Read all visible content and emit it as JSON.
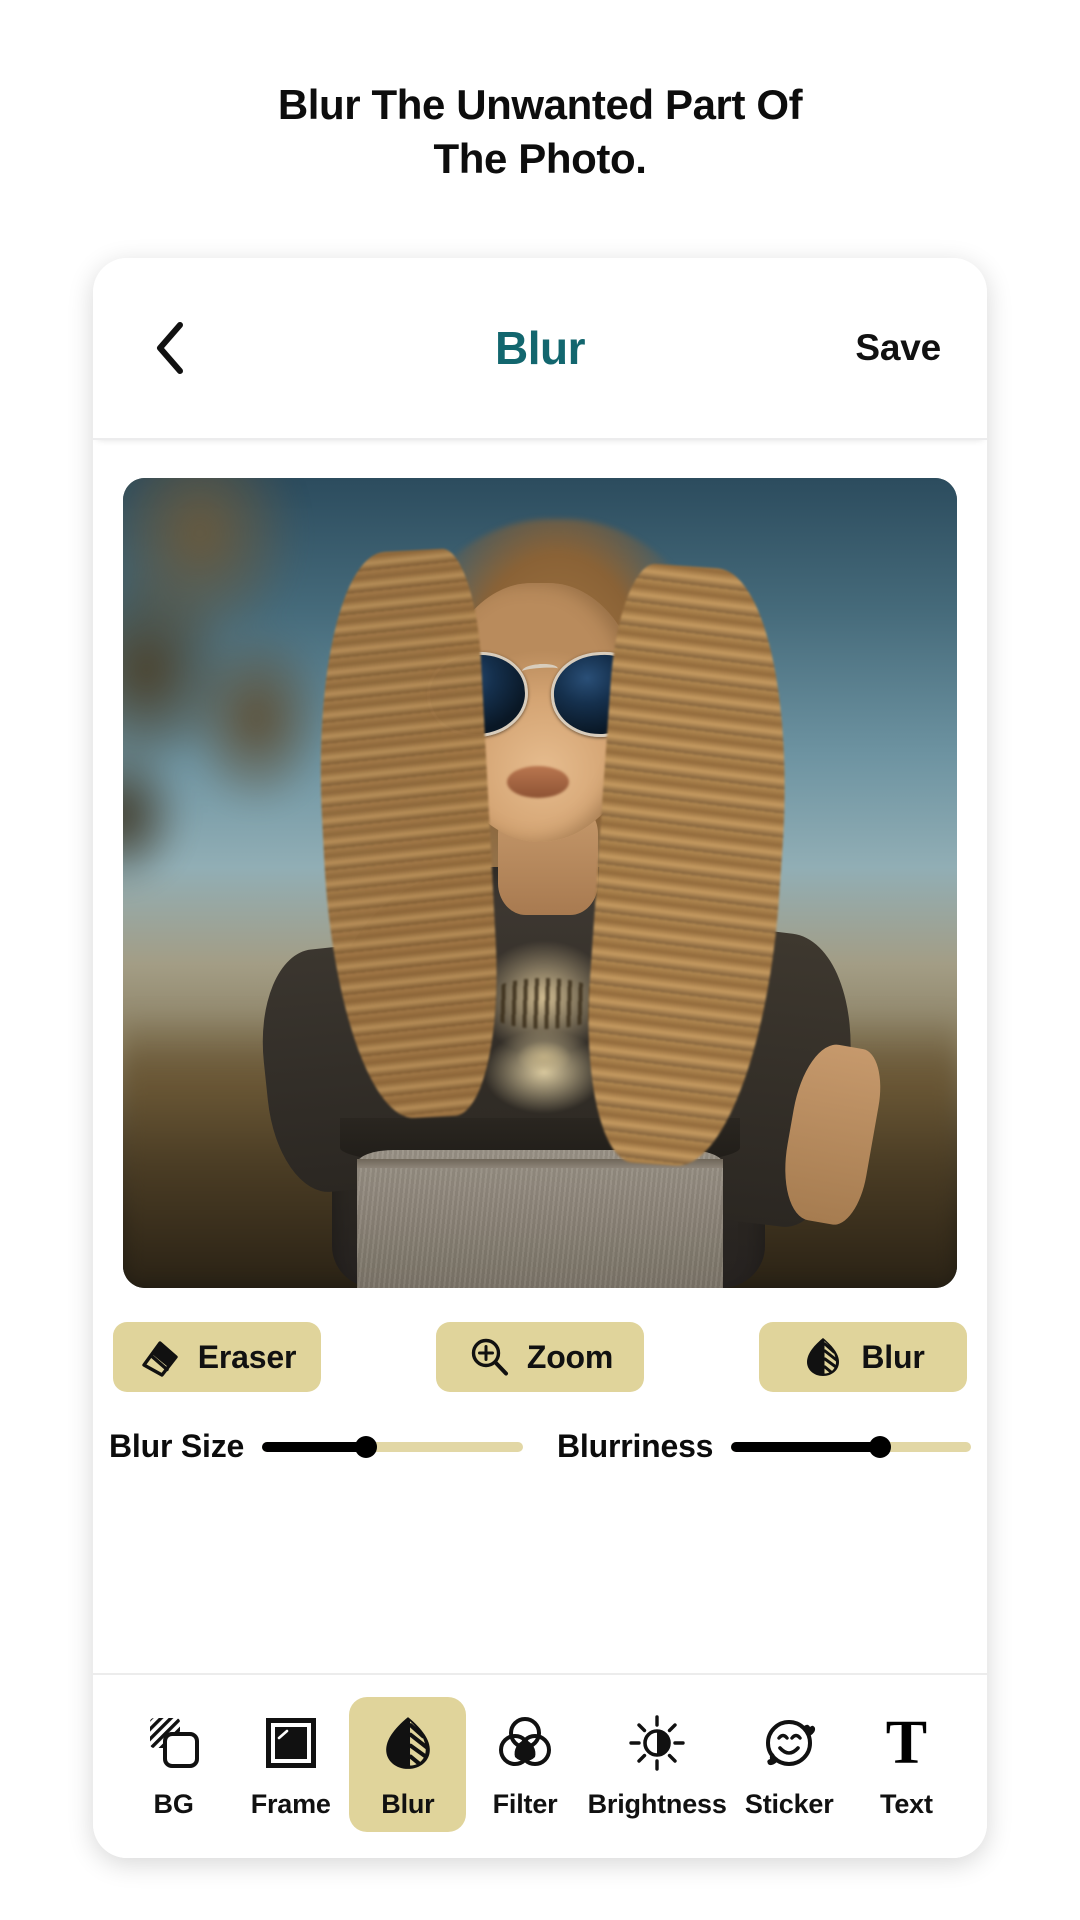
{
  "promo": {
    "headline_line1": "Blur The Unwanted Part Of",
    "headline_line2": "The Photo."
  },
  "colors": {
    "accent_teal": "#12666e",
    "tan": "#e0d49b",
    "track": "#e2d7a5",
    "bg_top": "#e4e0a8",
    "bg_bottom": "#108b82"
  },
  "header": {
    "back_icon": "chevron-left-icon",
    "title": "Blur",
    "save_label": "Save"
  },
  "editor": {
    "photo_alt": "woman-with-sunglasses-photo"
  },
  "tools": [
    {
      "label": "Eraser",
      "icon": "eraser-icon"
    },
    {
      "label": "Zoom",
      "icon": "zoom-in-icon"
    },
    {
      "label": "Blur",
      "icon": "blur-leaf-icon"
    }
  ],
  "sliders": [
    {
      "label": "Blur Size",
      "value": 40,
      "min": 0,
      "max": 100
    },
    {
      "label": "Blurriness",
      "value": 62,
      "min": 0,
      "max": 100
    }
  ],
  "bottom_nav": {
    "active": "Blur",
    "items": [
      {
        "label": "BG",
        "icon": "background-layers-icon"
      },
      {
        "label": "Frame",
        "icon": "photo-frame-icon"
      },
      {
        "label": "Blur",
        "icon": "blur-leaf-icon"
      },
      {
        "label": "Filter",
        "icon": "color-circles-icon"
      },
      {
        "label": "Brightness",
        "icon": "brightness-sun-icon"
      },
      {
        "label": "Sticker",
        "icon": "smiley-sticker-icon"
      },
      {
        "label": "Text",
        "icon": "text-t-icon"
      }
    ]
  }
}
